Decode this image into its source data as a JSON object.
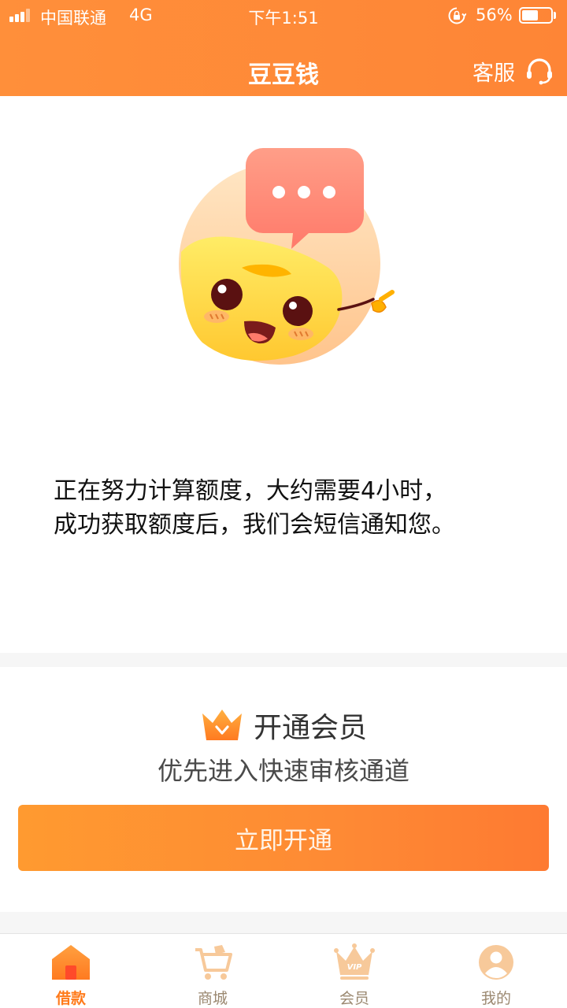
{
  "status_bar": {
    "carrier": "中国联通",
    "network": "4G",
    "time": "下午1:51",
    "battery": "56%",
    "battery_level": 0.56
  },
  "nav": {
    "title": "豆豆钱",
    "service_label": "客服"
  },
  "main": {
    "message_line1": "正在努力计算额度，大约需要4小时，",
    "message_line2": "成功获取额度后，我们会短信通知您。"
  },
  "membership": {
    "title": "开通会员",
    "subtitle": "优先进入快速审核通道",
    "button_label": "立即开通"
  },
  "tabs": [
    {
      "label": "借款",
      "icon": "home-icon",
      "active": true
    },
    {
      "label": "商城",
      "icon": "cart-icon",
      "active": false
    },
    {
      "label": "会员",
      "icon": "vip-crown-icon",
      "active": false
    },
    {
      "label": "我的",
      "icon": "profile-icon",
      "active": false
    }
  ],
  "colors": {
    "brand": "#fe8536",
    "button_start": "#ff9a30",
    "button_end": "#fe7a32",
    "active_tab": "#ff7a1a",
    "inactive_tab": "#9b8870"
  }
}
